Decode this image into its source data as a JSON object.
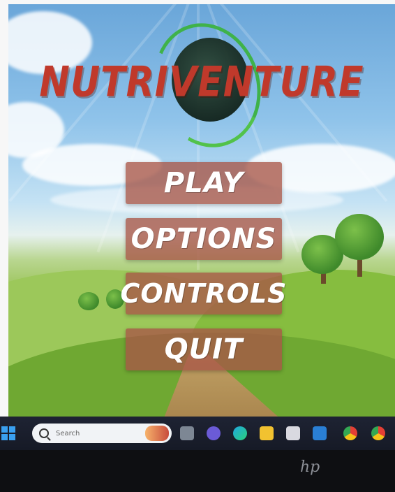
{
  "game": {
    "title": "NUTRIVENTURE",
    "menu": [
      {
        "id": "play",
        "label": "PLAY"
      },
      {
        "id": "options",
        "label": "OPTIONS"
      },
      {
        "id": "controls",
        "label": "CONTROLS"
      },
      {
        "id": "quit",
        "label": "QUIT"
      }
    ]
  },
  "taskbar": {
    "search_placeholder": "Search",
    "icons": [
      "windows-start-icon",
      "search-icon",
      "task-view-icon",
      "chat-icon",
      "edge-icon",
      "file-explorer-icon",
      "store-icon",
      "mail-icon",
      "chrome-icon",
      "chrome-icon"
    ]
  },
  "device": {
    "brand": "hp"
  },
  "colors": {
    "title_red": "#c0392b",
    "button_fill": "#a85646",
    "globe_ring_green": "#3fb24a",
    "taskbar_bg": "#1e2333"
  }
}
